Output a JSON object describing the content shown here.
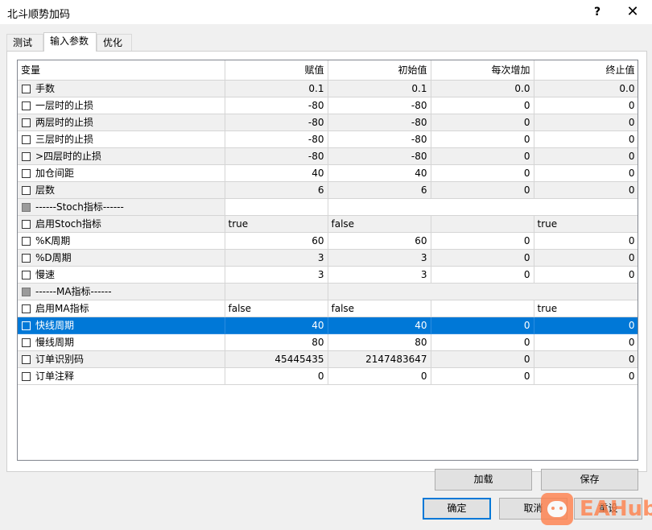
{
  "window": {
    "title": "北斗顺势加码",
    "help": "?",
    "close": "✕"
  },
  "tabs": [
    {
      "label": "测试",
      "active": false
    },
    {
      "label": "输入参数",
      "active": true
    },
    {
      "label": "优化",
      "active": false
    }
  ],
  "table": {
    "headers": [
      "变量",
      "赋值",
      "初始值",
      "每次增加",
      "终止值"
    ],
    "rows": [
      {
        "name": "手数",
        "value": "0.1",
        "initial": "0.1",
        "step": "0.0",
        "stop": "0.0",
        "kind": "num"
      },
      {
        "name": "一层时的止损",
        "value": "-80",
        "initial": "-80",
        "step": "0",
        "stop": "0",
        "kind": "num"
      },
      {
        "name": "两层时的止损",
        "value": "-80",
        "initial": "-80",
        "step": "0",
        "stop": "0",
        "kind": "num"
      },
      {
        "name": "三层时的止损",
        "value": "-80",
        "initial": "-80",
        "step": "0",
        "stop": "0",
        "kind": "num"
      },
      {
        "name": ">四层时的止损",
        "value": "-80",
        "initial": "-80",
        "step": "0",
        "stop": "0",
        "kind": "num"
      },
      {
        "name": "加仓间距",
        "value": "40",
        "initial": "40",
        "step": "0",
        "stop": "0",
        "kind": "num"
      },
      {
        "name": "层数",
        "value": "6",
        "initial": "6",
        "step": "0",
        "stop": "0",
        "kind": "num"
      },
      {
        "name": "------Stoch指标------",
        "value": "",
        "initial": "",
        "step": "",
        "stop": "",
        "kind": "sep"
      },
      {
        "name": "启用Stoch指标",
        "value": "true",
        "initial": "false",
        "step": "",
        "stop": "true",
        "kind": "bool"
      },
      {
        "name": "%K周期",
        "value": "60",
        "initial": "60",
        "step": "0",
        "stop": "0",
        "kind": "num"
      },
      {
        "name": "%D周期",
        "value": "3",
        "initial": "3",
        "step": "0",
        "stop": "0",
        "kind": "num"
      },
      {
        "name": "慢速",
        "value": "3",
        "initial": "3",
        "step": "0",
        "stop": "0",
        "kind": "num"
      },
      {
        "name": "------MA指标------",
        "value": "",
        "initial": "",
        "step": "",
        "stop": "",
        "kind": "sep"
      },
      {
        "name": "启用MA指标",
        "value": "false",
        "initial": "false",
        "step": "",
        "stop": "true",
        "kind": "bool"
      },
      {
        "name": "快线周期",
        "value": "40",
        "initial": "40",
        "step": "0",
        "stop": "0",
        "kind": "num",
        "selected": true
      },
      {
        "name": "慢线周期",
        "value": "80",
        "initial": "80",
        "step": "0",
        "stop": "0",
        "kind": "num"
      },
      {
        "name": "订单识别码",
        "value": "45445435",
        "initial": "2147483647",
        "step": "0",
        "stop": "0",
        "kind": "num"
      },
      {
        "name": "订单注释",
        "value": "0",
        "initial": "0",
        "step": "0",
        "stop": "0",
        "kind": "num"
      }
    ]
  },
  "buttons": {
    "load": "加载",
    "save": "保存",
    "ok": "确定",
    "cancel": "取消",
    "reset": "重设"
  },
  "watermark": {
    "text": "EAHub"
  },
  "colors": {
    "selection": "#0078d7",
    "alt_row": "#f0f0f0"
  }
}
